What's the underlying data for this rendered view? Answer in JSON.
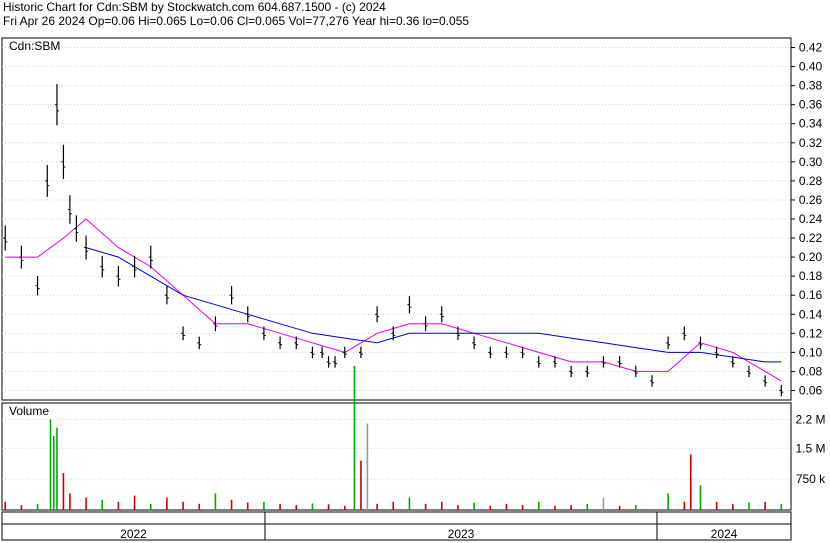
{
  "header": {
    "line1": "Historic Chart for Cdn:SBM by Stockwatch.com 604.687.1500 - (c) 2024",
    "line2": "Fri Apr 26 2024   Op=0.06   Hi=0.065   Lo=0.06   Cl=0.065   Vol=77,276   Year hi=0.36   lo=0.055"
  },
  "colors": {
    "up": "#00aa00",
    "down": "#cc0000",
    "neutral": "#999999",
    "ma_short": "#e000e0",
    "ma_long": "#0000cc",
    "bars": "#000000"
  },
  "chart_data": [
    {
      "type": "line",
      "title": "Cdn:SBM",
      "xlabel": "",
      "ylabel": "",
      "ylim": [
        0.05,
        0.43
      ],
      "y_ticks": [
        "0.42",
        "0.40",
        "0.38",
        "0.36",
        "0.34",
        "0.32",
        "0.30",
        "0.28",
        "0.26",
        "0.24",
        "0.22",
        "0.20",
        "0.18",
        "0.16",
        "0.14",
        "0.12",
        "0.10",
        "0.08",
        "0.06"
      ],
      "x_period_labels": [
        "2022",
        "2023",
        "2024"
      ],
      "grid": true,
      "series": [
        {
          "key": "price",
          "x": [
            2021.9,
            2021.95,
            2022.0,
            2022.03,
            2022.06,
            2022.08,
            2022.1,
            2022.12,
            2022.15,
            2022.2,
            2022.25,
            2022.3,
            2022.35,
            2022.4,
            2022.45,
            2022.5,
            2022.55,
            2022.6,
            2022.65,
            2022.7,
            2022.75,
            2022.8,
            2022.85,
            2022.88,
            2022.9,
            2022.92,
            2022.95,
            2023.0,
            2023.05,
            2023.1,
            2023.15,
            2023.2,
            2023.25,
            2023.3,
            2023.35,
            2023.4,
            2023.45,
            2023.5,
            2023.55,
            2023.6,
            2023.65,
            2023.7,
            2023.75,
            2023.8,
            2023.85,
            2023.9,
            2023.95,
            2024.0,
            2024.05,
            2024.1,
            2024.15,
            2024.2,
            2024.25,
            2024.3
          ],
          "values": [
            0.22,
            0.2,
            0.17,
            0.28,
            0.36,
            0.3,
            0.25,
            0.23,
            0.21,
            0.19,
            0.18,
            0.19,
            0.2,
            0.16,
            0.12,
            0.11,
            0.13,
            0.16,
            0.14,
            0.12,
            0.11,
            0.11,
            0.1,
            0.1,
            0.09,
            0.09,
            0.1,
            0.1,
            0.14,
            0.12,
            0.15,
            0.13,
            0.14,
            0.12,
            0.11,
            0.1,
            0.1,
            0.1,
            0.09,
            0.09,
            0.08,
            0.08,
            0.09,
            0.09,
            0.08,
            0.07,
            0.11,
            0.12,
            0.11,
            0.1,
            0.09,
            0.08,
            0.07,
            0.06
          ]
        },
        {
          "key": "ma_short",
          "x": [
            2021.9,
            2022.0,
            2022.08,
            2022.15,
            2022.25,
            2022.35,
            2022.45,
            2022.55,
            2022.65,
            2022.75,
            2022.85,
            2022.95,
            2023.05,
            2023.15,
            2023.25,
            2023.35,
            2023.45,
            2023.55,
            2023.65,
            2023.75,
            2023.85,
            2023.95,
            2024.05,
            2024.15,
            2024.25,
            2024.3
          ],
          "values": [
            0.2,
            0.2,
            0.22,
            0.24,
            0.21,
            0.19,
            0.16,
            0.13,
            0.13,
            0.12,
            0.11,
            0.1,
            0.12,
            0.13,
            0.13,
            0.12,
            0.11,
            0.1,
            0.09,
            0.09,
            0.08,
            0.08,
            0.11,
            0.1,
            0.08,
            0.07
          ]
        },
        {
          "key": "ma_long",
          "x": [
            2022.15,
            2022.25,
            2022.35,
            2022.45,
            2022.55,
            2022.65,
            2022.75,
            2022.85,
            2022.95,
            2023.05,
            2023.15,
            2023.25,
            2023.35,
            2023.45,
            2023.55,
            2023.65,
            2023.75,
            2023.85,
            2023.95,
            2024.05,
            2024.15,
            2024.25,
            2024.3
          ],
          "values": [
            0.21,
            0.2,
            0.18,
            0.16,
            0.15,
            0.14,
            0.13,
            0.12,
            0.115,
            0.11,
            0.12,
            0.12,
            0.12,
            0.12,
            0.12,
            0.115,
            0.11,
            0.105,
            0.1,
            0.1,
            0.095,
            0.09,
            0.09
          ]
        }
      ]
    },
    {
      "type": "bar",
      "title": "Volume",
      "ylim": [
        0,
        2600000
      ],
      "y_ticks": [
        "2.2 M",
        "1.5 M",
        "750 k"
      ],
      "series": [
        {
          "name": "Volume",
          "x": [
            2021.9,
            2021.95,
            2022.0,
            2022.04,
            2022.05,
            2022.06,
            2022.08,
            2022.1,
            2022.15,
            2022.2,
            2022.25,
            2022.3,
            2022.35,
            2022.4,
            2022.45,
            2022.5,
            2022.55,
            2022.6,
            2022.65,
            2022.7,
            2022.75,
            2022.8,
            2022.85,
            2022.9,
            2022.95,
            2022.98,
            2023.0,
            2023.02,
            2023.05,
            2023.1,
            2023.15,
            2023.2,
            2023.25,
            2023.3,
            2023.35,
            2023.4,
            2023.45,
            2023.5,
            2023.55,
            2023.6,
            2023.65,
            2023.7,
            2023.75,
            2023.8,
            2023.85,
            2023.95,
            2024.0,
            2024.02,
            2024.05,
            2024.1,
            2024.15,
            2024.2,
            2024.25,
            2024.3
          ],
          "values": [
            200000,
            120000,
            150000,
            2200000,
            1800000,
            2000000,
            900000,
            400000,
            300000,
            250000,
            200000,
            350000,
            150000,
            300000,
            200000,
            150000,
            400000,
            250000,
            180000,
            200000,
            150000,
            120000,
            160000,
            140000,
            100000,
            3500000,
            1200000,
            2100000,
            150000,
            200000,
            300000,
            150000,
            200000,
            120000,
            180000,
            100000,
            150000,
            120000,
            200000,
            100000,
            120000,
            150000,
            300000,
            100000,
            120000,
            400000,
            200000,
            1350000,
            600000,
            200000,
            150000,
            180000,
            200000,
            150000
          ],
          "dir": [
            "d",
            "d",
            "u",
            "u",
            "u",
            "u",
            "d",
            "d",
            "d",
            "u",
            "d",
            "d",
            "u",
            "d",
            "d",
            "d",
            "u",
            "d",
            "d",
            "u",
            "d",
            "d",
            "u",
            "d",
            "d",
            "u",
            "d",
            "n",
            "d",
            "d",
            "u",
            "d",
            "d",
            "d",
            "u",
            "d",
            "d",
            "d",
            "u",
            "d",
            "d",
            "u",
            "n",
            "d",
            "u",
            "u",
            "d",
            "d",
            "u",
            "d",
            "d",
            "u",
            "d",
            "u"
          ]
        }
      ]
    }
  ]
}
